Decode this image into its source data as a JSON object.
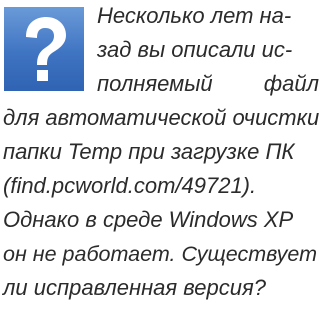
{
  "question": {
    "icon": "question-mark-icon",
    "icon_color": "#3f74c2",
    "lines": [
      "Несколько лет на-",
      "зад вы описали ис-",
      "полняемый",
      "файл",
      "для автоматической очистки",
      "папки Temp при загрузке ПК",
      "(find.pcworld.com/49721).",
      "Однако в среде Windows XP",
      "он не работает. Существует",
      "ли исправленная версия?"
    ]
  }
}
